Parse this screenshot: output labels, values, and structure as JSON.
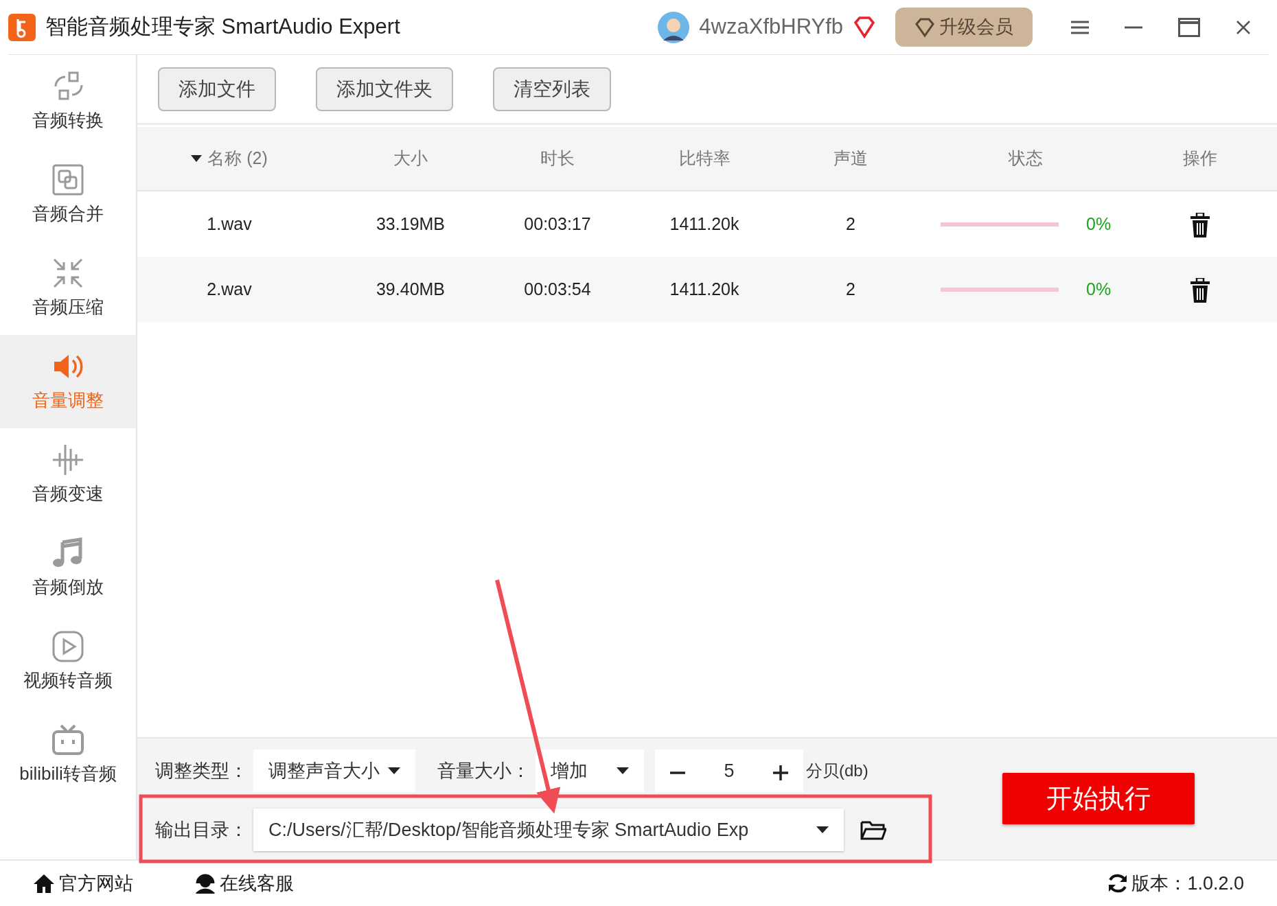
{
  "window": {
    "title": "智能音频处理专家 SmartAudio Expert"
  },
  "account": {
    "username": "4wzaXfbHRYfb",
    "upgrade_button": "升级会员"
  },
  "toolbar": [
    "添加文件",
    "添加文件夹",
    "清空列表"
  ],
  "sidebar": {
    "items": [
      {
        "label": "音频转换",
        "kind": "convert",
        "selected": false
      },
      {
        "label": "音频合并",
        "kind": "merge",
        "selected": false
      },
      {
        "label": "音频压缩",
        "kind": "compress",
        "selected": false
      },
      {
        "label": "音量调整",
        "kind": "volume",
        "selected": true
      },
      {
        "label": "音频变速",
        "kind": "speed",
        "selected": false
      },
      {
        "label": "音频倒放",
        "kind": "reverse",
        "selected": false
      },
      {
        "label": "视频转音频",
        "kind": "video",
        "selected": false
      },
      {
        "label": "bilibili转音频",
        "kind": "bilibili",
        "selected": false
      }
    ]
  },
  "table": {
    "columns": [
      "名称 (2)",
      "大小",
      "时长",
      "比特率",
      "声道",
      "状态",
      "操作"
    ],
    "rows": [
      {
        "name": "1.wav",
        "size": "33.19MB",
        "duration": "00:03:17",
        "bitrate": "1411.20k",
        "channels": "2",
        "level": 0,
        "progress": "0%"
      },
      {
        "name": "2.wav",
        "size": "39.40MB",
        "duration": "00:03:54",
        "bitrate": "1411.20k",
        "channels": "2",
        "level": 0,
        "progress": "0%"
      }
    ]
  },
  "settings": {
    "adjust_type_label": "调整类型：",
    "adjust_type": "调整声音大小",
    "volume_label": "音量大小：",
    "volume_mode": "增加",
    "value": "5",
    "unit": "分贝(db)",
    "output_label": "输出目录：",
    "output_path": "C:/Users/汇帮/Desktop/智能音频处理专家 SmartAudio Exp",
    "start_button": "开始执行"
  },
  "footer": {
    "links": [
      "官方网站",
      "在线客服"
    ],
    "version": "版本：1.0.2.0"
  }
}
